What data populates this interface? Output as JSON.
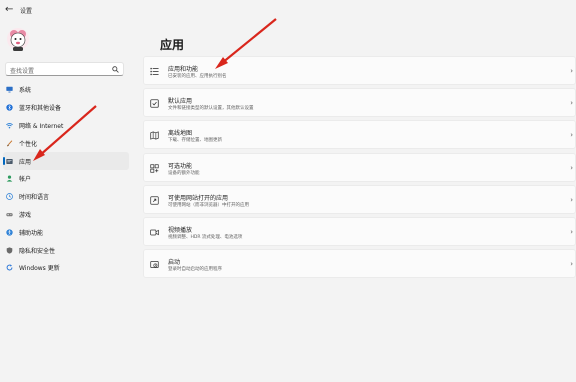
{
  "window": {
    "title": "设置",
    "back_glyph": "←"
  },
  "search": {
    "placeholder": "查找设置"
  },
  "sidebar": {
    "items": [
      {
        "label": "系统",
        "icon": "monitor-icon",
        "color": "#2b6fc6"
      },
      {
        "label": "蓝牙和其他设备",
        "icon": "bluetooth-icon",
        "color": "#1f6fd6"
      },
      {
        "label": "网络 & Internet",
        "icon": "wifi-icon",
        "color": "#2a7fd6"
      },
      {
        "label": "个性化",
        "icon": "brush-icon",
        "color": "#c9752c"
      },
      {
        "label": "应用",
        "icon": "apps-icon",
        "color": "#4a5a6a",
        "active": true
      },
      {
        "label": "帐户",
        "icon": "person-icon",
        "color": "#2e9b5f"
      },
      {
        "label": "时间和语言",
        "icon": "globe-clock-icon",
        "color": "#2a7fd6"
      },
      {
        "label": "游戏",
        "icon": "gamepad-icon",
        "color": "#7a7a7a"
      },
      {
        "label": "辅助功能",
        "icon": "accessibility-icon",
        "color": "#2a7fd6"
      },
      {
        "label": "隐私和安全性",
        "icon": "shield-icon",
        "color": "#6b6b6b"
      },
      {
        "label": "Windows 更新",
        "icon": "update-icon",
        "color": "#1f6fd6"
      }
    ]
  },
  "main": {
    "title": "应用",
    "cards": [
      {
        "title": "应用和功能",
        "desc": "已安装的应用、应用执行别名",
        "icon": "apps-list-icon"
      },
      {
        "title": "默认应用",
        "desc": "文件和链接类型的默认设置，其他默认设置",
        "icon": "default-apps-icon"
      },
      {
        "title": "离线地图",
        "desc": "下载、存储位置、地图更新",
        "icon": "map-icon"
      },
      {
        "title": "可选功能",
        "desc": "设备的额外功能",
        "icon": "optional-features-icon"
      },
      {
        "title": "可使用网站打开的应用",
        "desc": "可使用网站（而非浏览器）中打开的应用",
        "icon": "web-apps-icon"
      },
      {
        "title": "视频播放",
        "desc": "视频调整、HDR 流式处理、电池选项",
        "icon": "video-icon"
      },
      {
        "title": "启动",
        "desc": "登录时自动启动的应用程序",
        "icon": "startup-icon"
      }
    ],
    "chevron": "›"
  },
  "colors": {
    "accent": "#0067c0",
    "annotation": "#d9261c"
  }
}
